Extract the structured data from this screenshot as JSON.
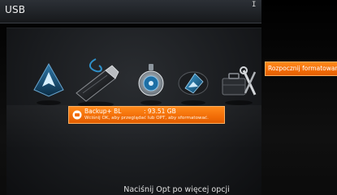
{
  "header": {
    "title": "USB",
    "indicator": "I"
  },
  "menu": {
    "items": [
      {
        "icon": "navigation-icon"
      },
      {
        "icon": "usb-drive-icon",
        "selected": true
      },
      {
        "icon": "clock-icon"
      },
      {
        "icon": "photo-icon"
      },
      {
        "icon": "tools-icon"
      }
    ]
  },
  "storage": {
    "name": "Backup+ BL",
    "size": ": 93.51 GB",
    "hint": "Wciśnij OK, aby przeglądać lub OPT, aby sformatować."
  },
  "footer": {
    "hint": "Naciśnij Opt po więcej opcji"
  },
  "side_action": {
    "label": "Rozpocznij formatowanie"
  },
  "colors": {
    "accent": "#f26d07",
    "header_bg": "#1f2226",
    "panel_bg": "#1a1c1f"
  }
}
